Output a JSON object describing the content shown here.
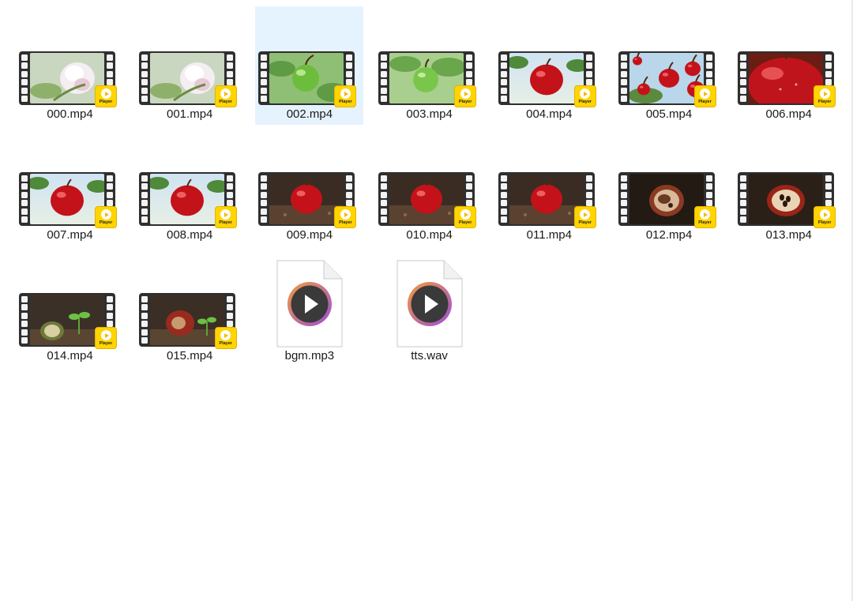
{
  "files": [
    {
      "name": "000.mp4",
      "type": "video",
      "scene": "blossom"
    },
    {
      "name": "001.mp4",
      "type": "video",
      "scene": "blossom"
    },
    {
      "name": "002.mp4",
      "type": "video",
      "scene": "green-apple",
      "selected": true
    },
    {
      "name": "003.mp4",
      "type": "video",
      "scene": "green-apple-tree"
    },
    {
      "name": "004.mp4",
      "type": "video",
      "scene": "red-apple-sky"
    },
    {
      "name": "005.mp4",
      "type": "video",
      "scene": "falling-apples"
    },
    {
      "name": "006.mp4",
      "type": "video",
      "scene": "red-apple-closeup"
    },
    {
      "name": "007.mp4",
      "type": "video",
      "scene": "red-apple-sky"
    },
    {
      "name": "008.mp4",
      "type": "video",
      "scene": "red-apple-sky"
    },
    {
      "name": "009.mp4",
      "type": "video",
      "scene": "apple-on-ground"
    },
    {
      "name": "010.mp4",
      "type": "video",
      "scene": "apple-on-ground"
    },
    {
      "name": "011.mp4",
      "type": "video",
      "scene": "apple-on-ground"
    },
    {
      "name": "012.mp4",
      "type": "video",
      "scene": "rotting-apple"
    },
    {
      "name": "013.mp4",
      "type": "video",
      "scene": "rotten-apple-seeds"
    },
    {
      "name": "014.mp4",
      "type": "video",
      "scene": "sprout"
    },
    {
      "name": "015.mp4",
      "type": "video",
      "scene": "rotten-apple-sprout"
    },
    {
      "name": "bgm.mp3",
      "type": "audio"
    },
    {
      "name": "tts.wav",
      "type": "audio"
    }
  ],
  "badge_label": "Player",
  "icons": {
    "video_badge": "player-badge-icon",
    "audio_file": "media-file-icon"
  },
  "colors": {
    "selection": "#e5f3ff",
    "badge": "#ffd400",
    "film": "#2f2f2f",
    "audio_ring_start": "#f39a3c",
    "audio_ring_end": "#9b4fd8"
  }
}
